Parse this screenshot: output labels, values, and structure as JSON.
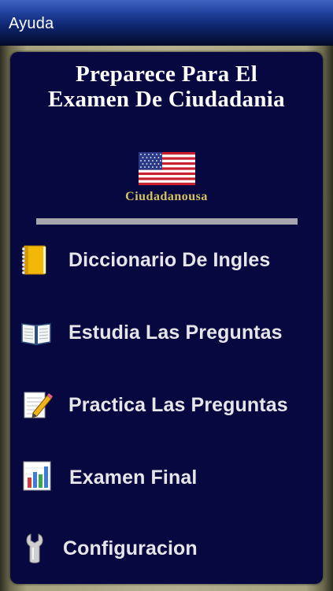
{
  "nav": {
    "back_label": "Ayuda"
  },
  "header": {
    "title_line1": "Preparece Para El",
    "title_line2": "Examen De Ciudadania",
    "brand": "Ciudadanousa"
  },
  "menu": {
    "items": [
      {
        "label": "Diccionario De Ingles",
        "icon": "notebook-icon"
      },
      {
        "label": "Estudia Las Preguntas",
        "icon": "open-book-icon"
      },
      {
        "label": "Practica Las Preguntas",
        "icon": "memo-pencil-icon"
      },
      {
        "label": "Examen Final",
        "icon": "bar-chart-icon"
      },
      {
        "label": "Configuracion",
        "icon": "wrench-icon"
      }
    ]
  },
  "colors": {
    "panel": "#07083f",
    "brand_gold": "#d6c261",
    "divider": "#a5a5ad"
  }
}
